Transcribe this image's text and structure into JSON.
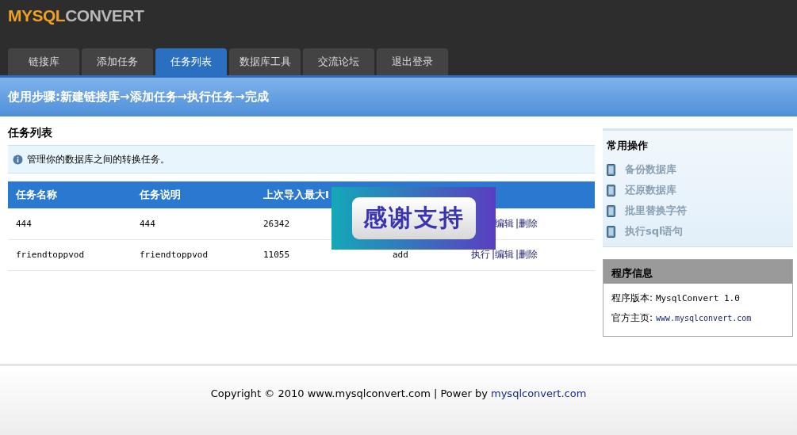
{
  "logo": {
    "part_1": "MYSQL",
    "part_2": "CONVERT"
  },
  "tabs": [
    {
      "label": "链接库",
      "selected": false
    },
    {
      "label": "添加任务",
      "selected": false
    },
    {
      "label": "任务列表",
      "selected": true
    },
    {
      "label": "数据库工具",
      "selected": false
    },
    {
      "label": "交流论坛",
      "selected": false
    },
    {
      "label": "退出登录",
      "selected": false
    }
  ],
  "steps_banner": "使用步骤:新建链接库→添加任务→执行任务→完成",
  "main": {
    "title": "任务列表",
    "notice": "管理你的数据库之间的转换任务。",
    "table": {
      "columns": [
        "任务名称",
        "任务说明",
        "上次导入最大I"
      ],
      "rows": [
        {
          "cells": [
            "444",
            "444",
            "26342",
            ""
          ],
          "actions": [
            "编辑",
            "|删除"
          ]
        },
        {
          "cells": [
            "friendtoppvod",
            "friendtoppvod",
            "11055",
            "add"
          ],
          "actions": [
            "执行",
            "|编辑",
            "|删除"
          ]
        }
      ]
    },
    "overlay_badge": "感谢支持"
  },
  "sidebar": {
    "quick_title": "常用操作",
    "quick_items": [
      "备份数据库",
      "还原数据库",
      "批里替换字符",
      "执行sql语句"
    ],
    "info_title": "程序信息",
    "info": [
      {
        "label": "程序版本:",
        "value": "MysqlConvert 1.0"
      },
      {
        "label": "官方主页:",
        "value": "www.mysqlconvert.com"
      }
    ]
  },
  "footer": {
    "text": "Copyright © 2010 www.mysqlconvert.com | Power by",
    "link": "mysqlconvert.com"
  }
}
